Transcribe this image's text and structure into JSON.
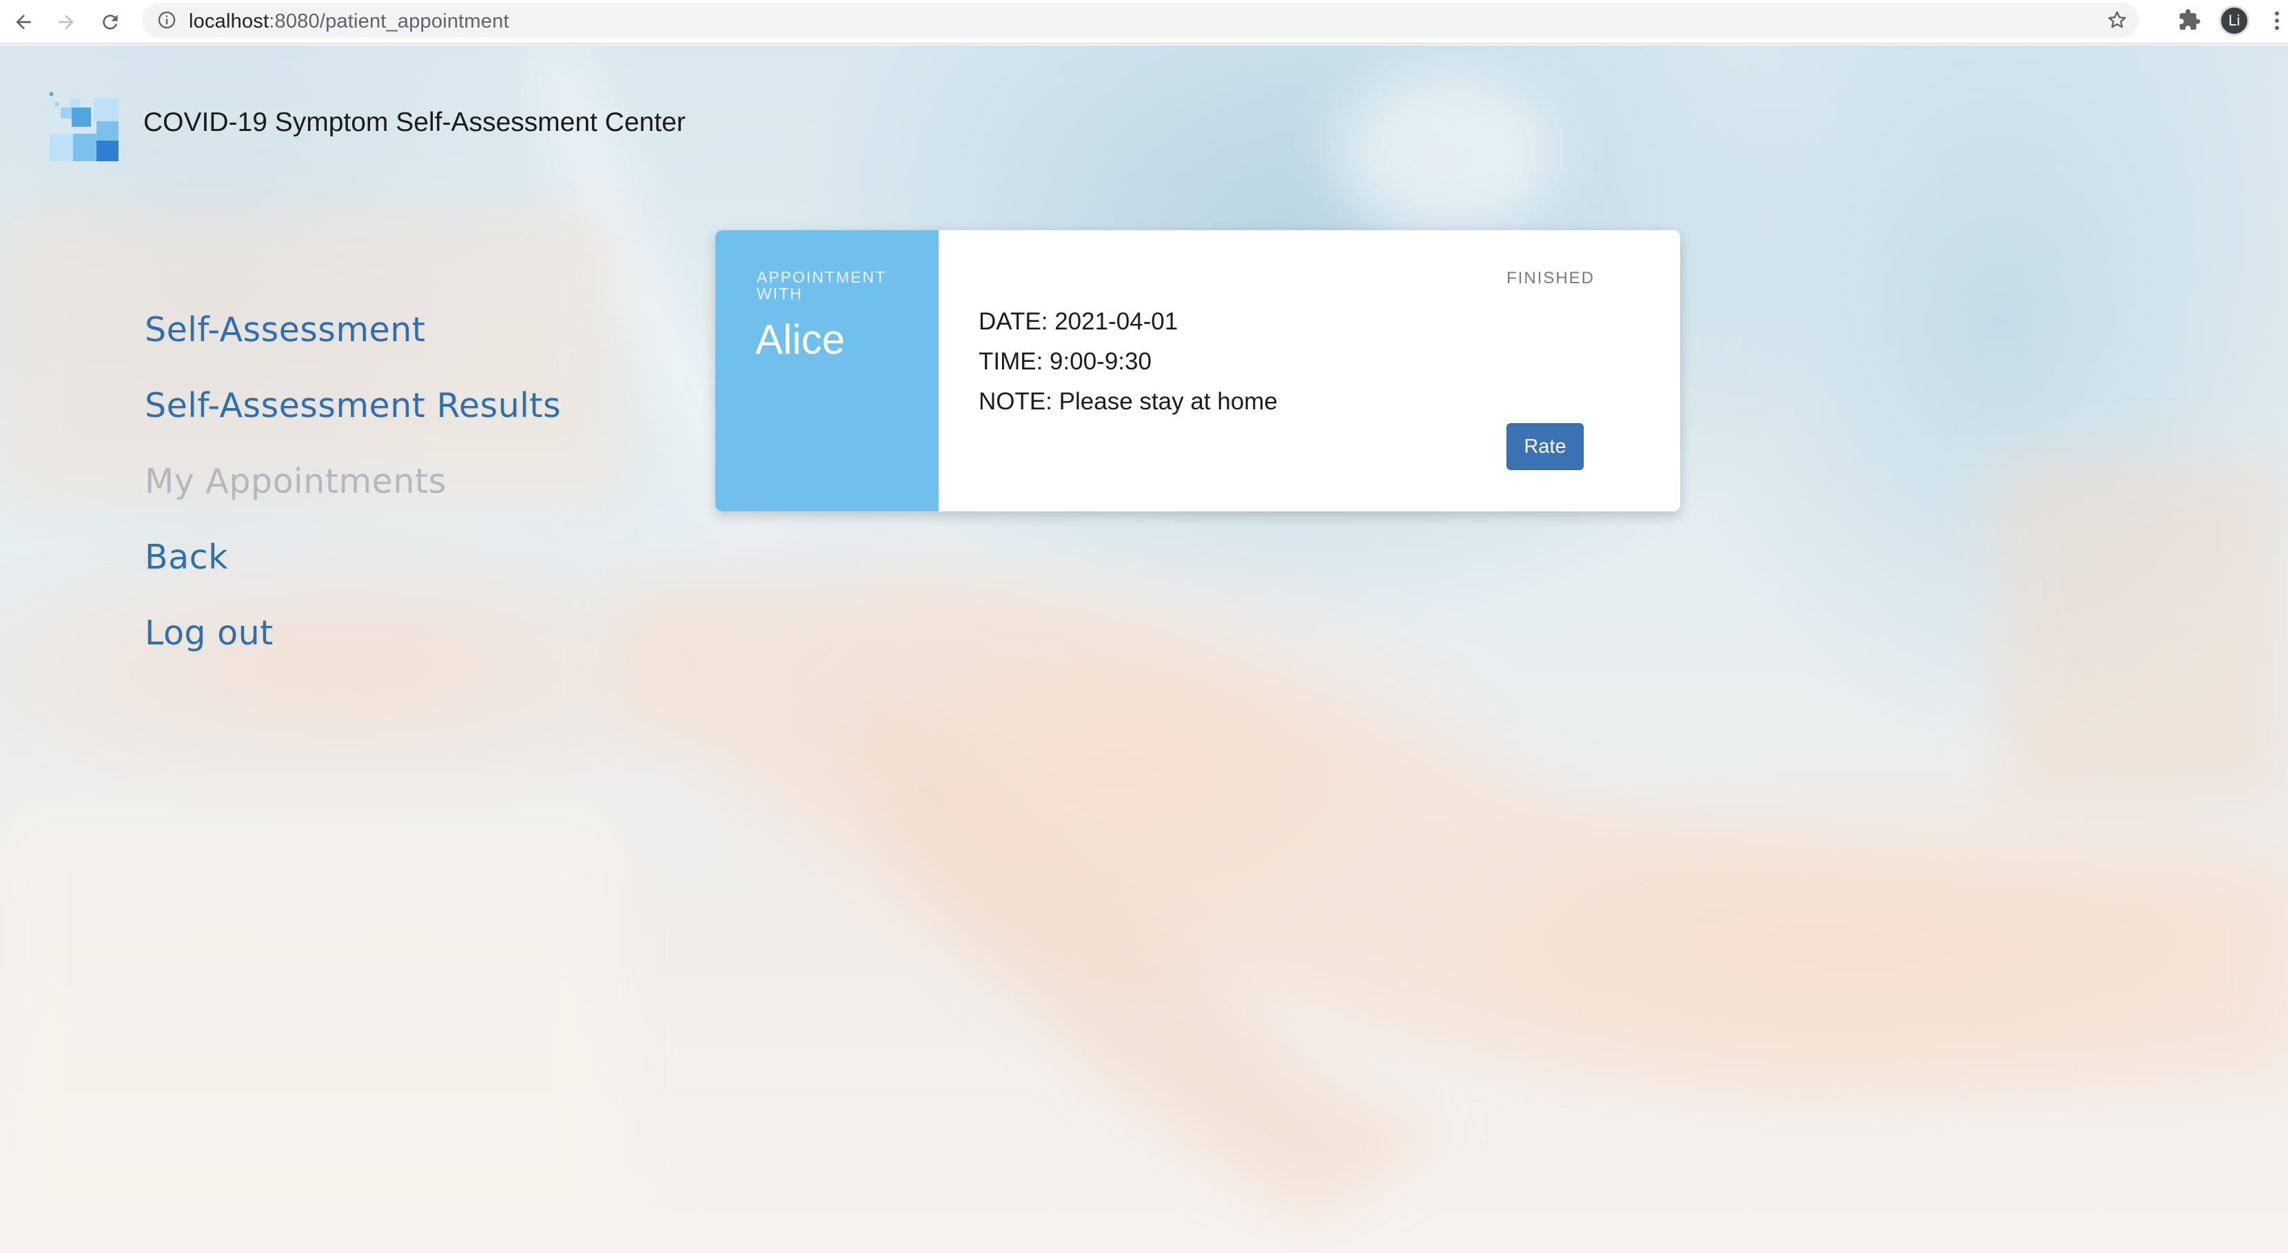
{
  "browser": {
    "url_host": "localhost",
    "url_path": ":8080/patient_appointment",
    "profile_initial": "Li",
    "icons": [
      "back-arrow-icon",
      "forward-arrow-icon",
      "reload-icon",
      "info-icon",
      "star-icon",
      "puzzle-extension-icon",
      "kebab-menu-icon"
    ]
  },
  "header": {
    "title": "COVID-19 Symptom Self-Assessment Center",
    "logo": "pixel-squares-logo"
  },
  "nav": {
    "items": [
      {
        "label": "Self-Assessment",
        "active": false
      },
      {
        "label": "Self-Assessment Results",
        "active": false
      },
      {
        "label": "My Appointments",
        "active": true
      },
      {
        "label": "Back",
        "active": false
      },
      {
        "label": "Log out",
        "active": false
      }
    ]
  },
  "appointment": {
    "caption": "APPOINTMENT WITH",
    "doctor": "Alice",
    "status": "FINISHED",
    "date": "DATE: 2021-04-01",
    "time": "TIME: 9:00-9:30",
    "note": "NOTE: Please stay at home",
    "action_label": "Rate"
  },
  "colors": {
    "nav_link": "#2f6eb0",
    "nav_active": "#b3b8bc",
    "card_accent": "#70bfec",
    "button": "#3b72b3"
  }
}
